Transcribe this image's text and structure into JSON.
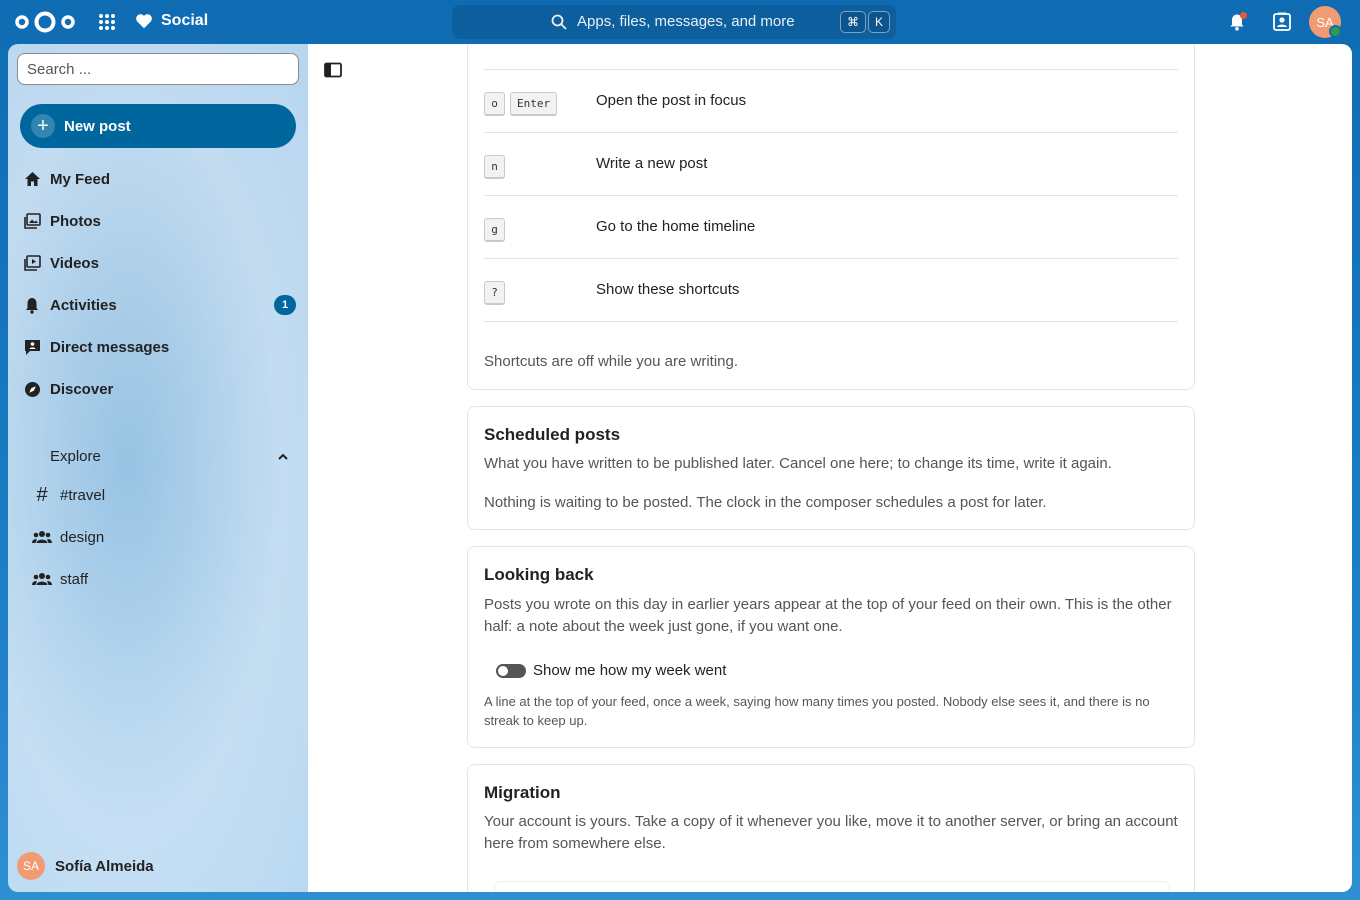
{
  "header": {
    "app_name": "Social",
    "search_placeholder": "Apps, files, messages, and more",
    "shortcut_keys": [
      "⌘",
      "K"
    ],
    "avatar_initials": "SA"
  },
  "sidebar": {
    "search_placeholder": "Search ...",
    "new_post_label": "New post",
    "items": [
      {
        "label": "My Feed",
        "icon": "home-icon"
      },
      {
        "label": "Photos",
        "icon": "image-icon"
      },
      {
        "label": "Videos",
        "icon": "video-icon"
      },
      {
        "label": "Activities",
        "icon": "bell-icon",
        "badge": "1"
      },
      {
        "label": "Direct messages",
        "icon": "message-icon"
      },
      {
        "label": "Discover",
        "icon": "compass-icon"
      }
    ],
    "explore": {
      "heading": "Explore",
      "items": [
        {
          "label": "#travel",
          "icon": "hashtag-icon"
        },
        {
          "label": "design",
          "icon": "group-icon"
        },
        {
          "label": "staff",
          "icon": "group-icon"
        }
      ]
    },
    "profile": {
      "name": "Sofía Almeida",
      "initials": "SA"
    }
  },
  "shortcuts": {
    "rows": [
      {
        "keys": [
          "o",
          "Enter"
        ],
        "description": "Open the post in focus"
      },
      {
        "keys": [
          "n"
        ],
        "description": "Write a new post"
      },
      {
        "keys": [
          "g"
        ],
        "description": "Go to the home timeline"
      },
      {
        "keys": [
          "?"
        ],
        "description": "Show these shortcuts"
      }
    ],
    "footer": "Shortcuts are off while you are writing."
  },
  "scheduled": {
    "title": "Scheduled posts",
    "description": "What you have written to be published later. Cancel one here; to change its time, write it again.",
    "empty": "Nothing is waiting to be posted. The clock in the composer schedules a post for later."
  },
  "looking_back": {
    "title": "Looking back",
    "description": "Posts you wrote on this day in earlier years appear at the top of your feed on their own. This is the other half: a note about the week just gone, if you want one.",
    "toggle_label": "Show me how my week went",
    "toggle_on": false,
    "hint": "A line at the top of your feed, once a week, saying how many times you posted. Nobody else sees it, and there is no streak to keep up."
  },
  "migration": {
    "title": "Migration",
    "description": "Your account is yours. Take a copy of it whenever you like, move it to another server, or bring an account here from somewhere else."
  },
  "colors": {
    "primary": "#00679e",
    "header_bg": "#0f6cb3",
    "avatar": "#f19b74",
    "status_online": "#2d9c4e",
    "notification_dot": "#e9583a"
  }
}
